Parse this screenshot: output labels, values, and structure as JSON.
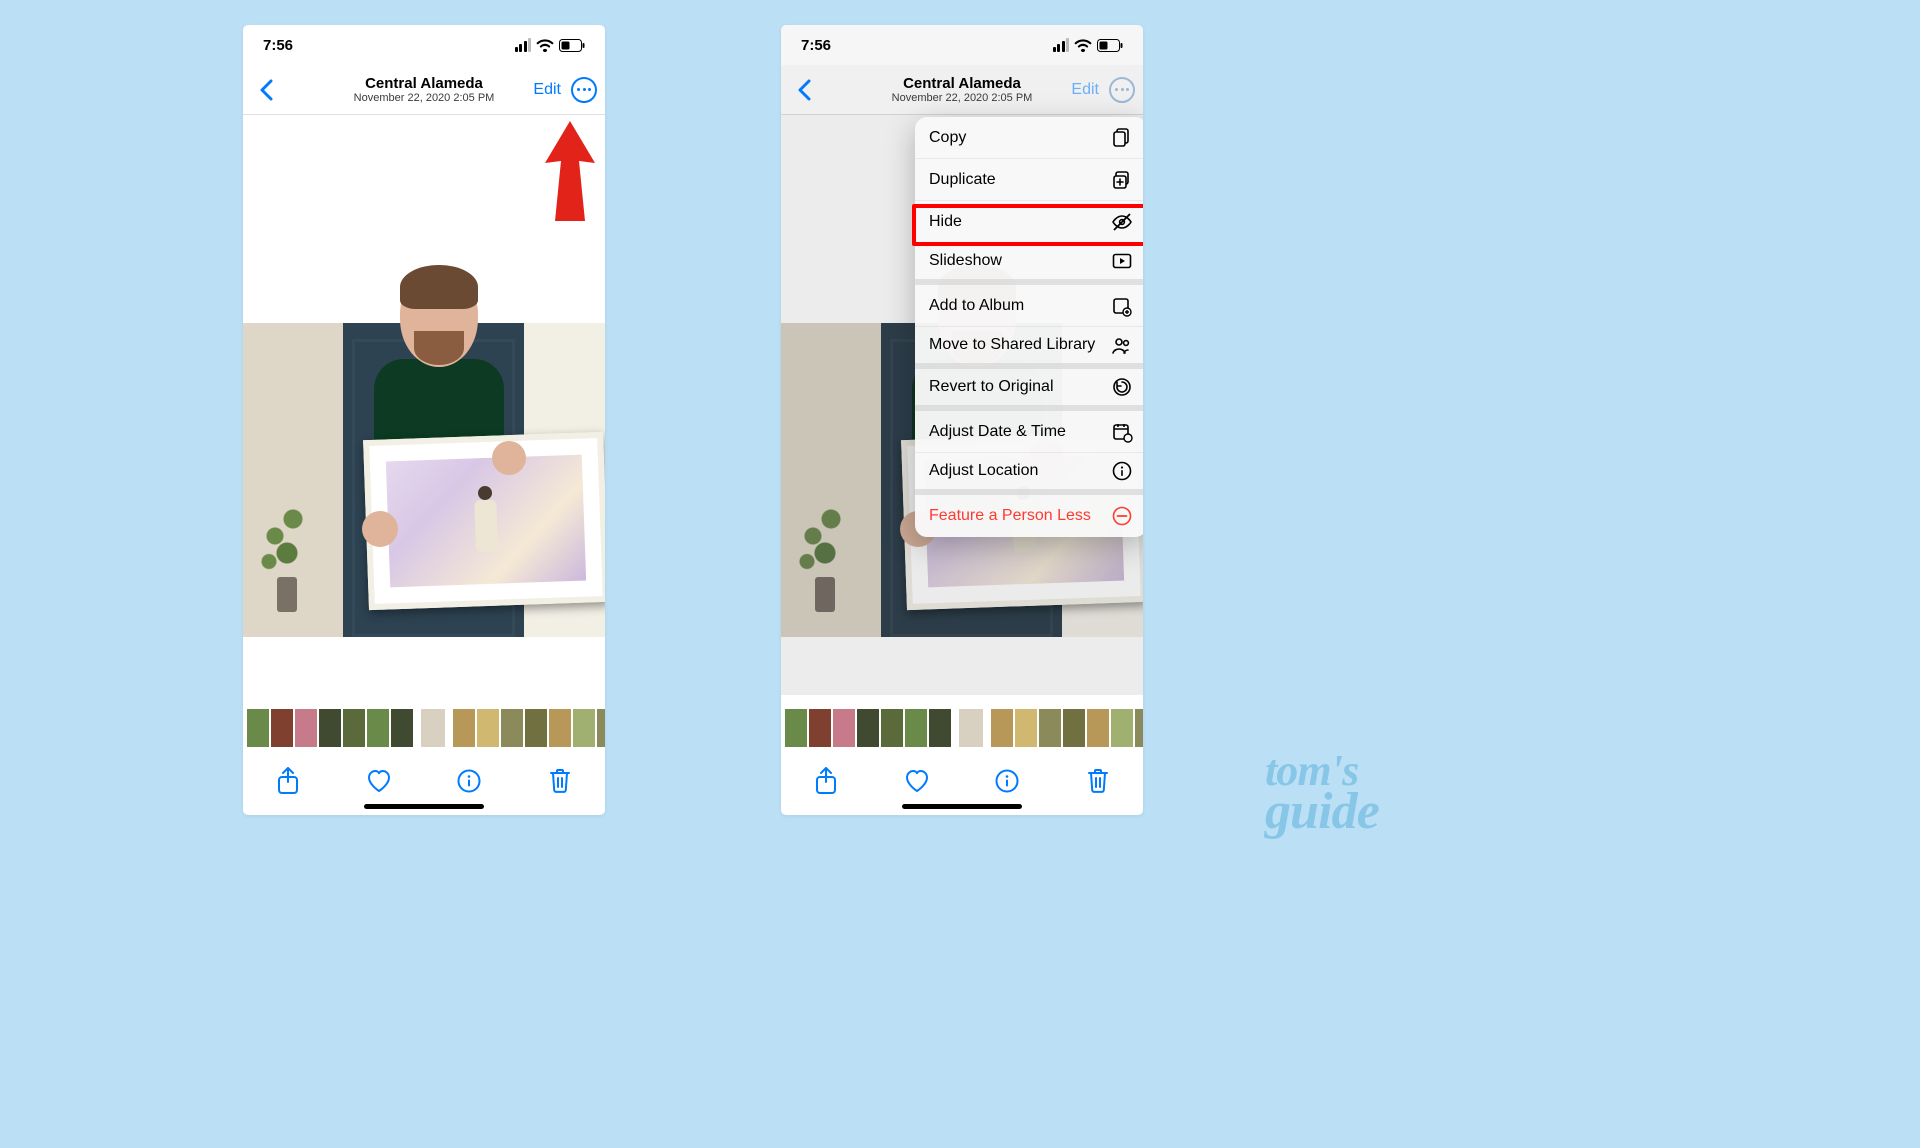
{
  "status": {
    "time": "7:56"
  },
  "nav": {
    "location": "Central Alameda",
    "datetime": "November 22, 2020  2:05 PM",
    "edit": "Edit"
  },
  "menu": {
    "copy": "Copy",
    "duplicate": "Duplicate",
    "hide": "Hide",
    "slideshow": "Slideshow",
    "add_album": "Add to Album",
    "move_shared": "Move to Shared Library",
    "revert": "Revert to Original",
    "adjust_date": "Adjust Date & Time",
    "adjust_location": "Adjust Location",
    "feature_less": "Feature a Person Less"
  },
  "watermark": {
    "line1": "tom's",
    "line2": "guide"
  }
}
